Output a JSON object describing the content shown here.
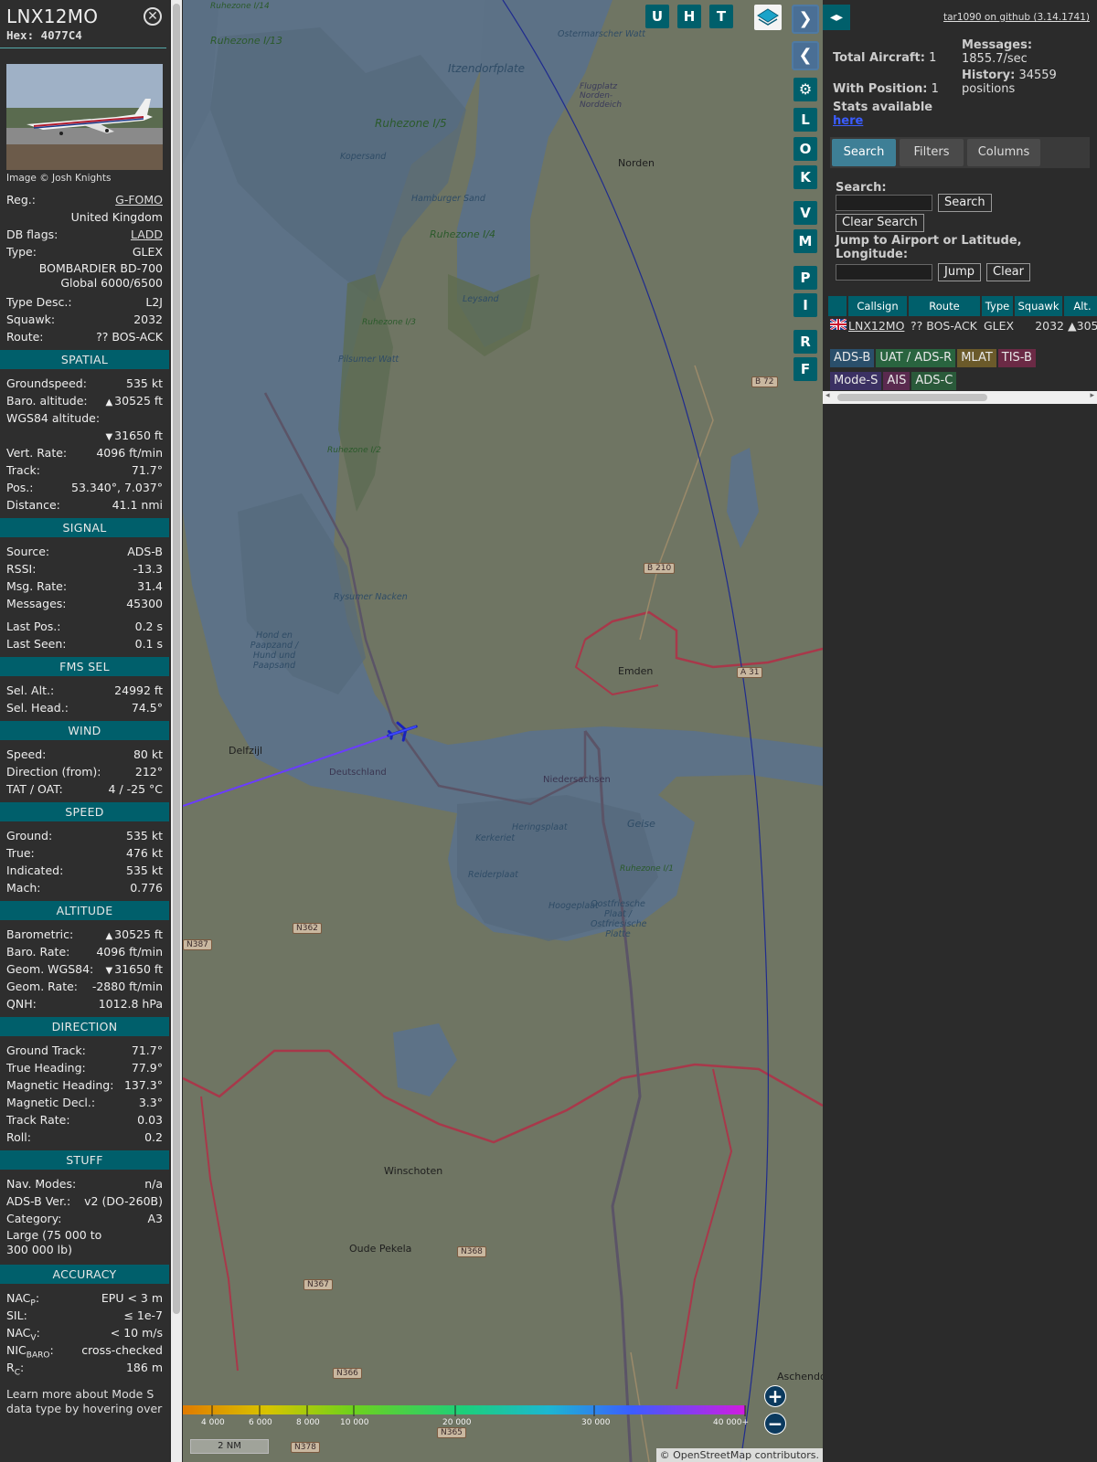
{
  "sidebar": {
    "callsign": "LNX12MO",
    "hex": "Hex: 4077C4",
    "photo_credit": "Image © Josh Knights",
    "info": [
      {
        "k": "Reg.:",
        "v": "G-FOMO",
        "link": true
      },
      {
        "k": "",
        "v": "United Kingdom"
      },
      {
        "k": "DB flags:",
        "v": "LADD",
        "link": true
      },
      {
        "k": "Type:",
        "v": "GLEX"
      },
      {
        "k": "",
        "v": "BOMBARDIER BD-700 Global 6000/6500",
        "tall": true
      },
      {
        "k": "Type Desc.:",
        "v": "L2J"
      },
      {
        "k": "Squawk:",
        "v": "2032"
      },
      {
        "k": "Route:",
        "v": "?? BOS-ACK"
      }
    ],
    "sections": [
      {
        "title": "SPATIAL",
        "rows": [
          {
            "k": "Groundspeed:",
            "v": "535 kt"
          },
          {
            "k": "Baro. altitude:",
            "v": "30525 ft",
            "arrow": "up"
          },
          {
            "k": "WGS84 altitude:",
            "v": ""
          },
          {
            "k": "",
            "v": "31650 ft",
            "arrow": "down"
          },
          {
            "k": "Vert. Rate:",
            "v": "4096 ft/min"
          },
          {
            "k": "Track:",
            "v": "71.7°"
          },
          {
            "k": "Pos.:",
            "v": "53.340°, 7.037°"
          },
          {
            "k": "Distance:",
            "v": "41.1 nmi"
          }
        ]
      },
      {
        "title": "SIGNAL",
        "rows": [
          {
            "k": "Source:",
            "v": "ADS-B"
          },
          {
            "k": "RSSI:",
            "v": "-13.3"
          },
          {
            "k": "Msg. Rate:",
            "v": "31.4"
          },
          {
            "k": "Messages:",
            "v": "45300"
          },
          {
            "k": "",
            "v": "",
            "gap": true
          },
          {
            "k": "Last Pos.:",
            "v": "0.2 s"
          },
          {
            "k": "Last Seen:",
            "v": "0.1 s"
          }
        ]
      },
      {
        "title": "FMS SEL",
        "rows": [
          {
            "k": "Sel. Alt.:",
            "v": "24992 ft"
          },
          {
            "k": "Sel. Head.:",
            "v": "74.5°"
          }
        ]
      },
      {
        "title": "WIND",
        "rows": [
          {
            "k": "Speed:",
            "v": "80 kt"
          },
          {
            "k": "Direction (from):",
            "v": "212°"
          },
          {
            "k": "TAT / OAT:",
            "v": "4 / -25 °C"
          }
        ]
      },
      {
        "title": "SPEED",
        "rows": [
          {
            "k": "Ground:",
            "v": "535 kt"
          },
          {
            "k": "True:",
            "v": "476 kt"
          },
          {
            "k": "Indicated:",
            "v": "535 kt"
          },
          {
            "k": "Mach:",
            "v": "0.776"
          }
        ]
      },
      {
        "title": "ALTITUDE",
        "rows": [
          {
            "k": "Barometric:",
            "v": "30525 ft",
            "arrow": "up"
          },
          {
            "k": "Baro. Rate:",
            "v": "4096 ft/min"
          },
          {
            "k": "Geom. WGS84:",
            "v": "31650 ft",
            "arrow": "down"
          },
          {
            "k": "Geom. Rate:",
            "v": "-2880 ft/min"
          },
          {
            "k": "QNH:",
            "v": "1012.8 hPa"
          }
        ]
      },
      {
        "title": "DIRECTION",
        "rows": [
          {
            "k": "Ground Track:",
            "v": "71.7°"
          },
          {
            "k": "True Heading:",
            "v": "77.9°"
          },
          {
            "k": "Magnetic Heading:",
            "v": "137.3°"
          },
          {
            "k": "Magnetic Decl.:",
            "v": "3.3°"
          },
          {
            "k": "Track Rate:",
            "v": "0.03"
          },
          {
            "k": "Roll:",
            "v": "0.2"
          }
        ]
      },
      {
        "title": "STUFF",
        "rows": [
          {
            "k": "Nav. Modes:",
            "v": "n/a"
          },
          {
            "k": "ADS-B Ver.:",
            "v": "v2 (DO-260B)"
          },
          {
            "k": "Category:",
            "v": "A3"
          },
          {
            "k": "Large (75 000 to 300 000 lb)",
            "v": "",
            "tallk": true
          }
        ]
      },
      {
        "title": "ACCURACY",
        "rows": [
          {
            "k": "NAC",
            "sub": "P",
            "v": "EPU < 3 m"
          },
          {
            "k": "SIL:",
            "v": "≤ 1e-7"
          },
          {
            "k": "NAC",
            "sub": "V",
            "v": "< 10 m/s"
          },
          {
            "k": "NIC",
            "sub": "BARO",
            "v": "cross-checked"
          },
          {
            "k": "R",
            "sub": "C",
            "v": "186 m"
          }
        ]
      }
    ],
    "learn_more": "Learn more about Mode S data type by hovering over"
  },
  "map": {
    "buttons_top": [
      "U",
      "H",
      "T"
    ],
    "buttons_side": [
      "L",
      "O",
      "K",
      "V",
      "M",
      "P",
      "I",
      "R",
      "F"
    ],
    "towns": [
      {
        "name": "Norden"
      },
      {
        "name": "Emden"
      },
      {
        "name": "Delfzijl"
      },
      {
        "name": "Winschoten"
      },
      {
        "name": "Oude Pekela"
      },
      {
        "name": "Aschendo"
      }
    ],
    "zones": [
      "Ruhezone I/5",
      "Ruhezone I/4",
      "Ruhezone I/13",
      "Ruhezone I/3",
      "Ruhezone I/2",
      "Ruhezone I/1",
      "Ruhezone I/14"
    ],
    "water_labels": [
      "Itzendorfplate",
      "Ostermarscher Watt",
      "Kopersand",
      "Hamburger Sand",
      "Leysand",
      "Pilsumer Watt",
      "Rysumer Nacken",
      "Hond en Paapzand / Hund und Paapsand",
      "Heringsplaat",
      "Kerkeriet",
      "Geise",
      "Reiderplaat",
      "Hoogeplaat",
      "Oostfriesche Plaat / Ostfriesische Platte",
      "Niedersachsen",
      "Deutschland",
      "Flugplatz Norden-Norddeich"
    ],
    "roads": [
      "B 72",
      "B 210",
      "A 31",
      "N362",
      "N387",
      "N367",
      "N368",
      "N366",
      "N365",
      "N378"
    ],
    "alt_scale": [
      "4 000",
      "6 000",
      "8 000",
      "10 000",
      "20 000",
      "30 000",
      "40 000+"
    ],
    "scale_label": "2 NM",
    "attribution_prefix": "© ",
    "attribution_link": "OpenStreetMap",
    "attribution_suffix": " contributors.",
    "zoom_in": "+",
    "zoom_out": "−"
  },
  "panel": {
    "github": "tar1090 on github (3.14.1741)",
    "total_aircraft_label": "Total Aircraft:",
    "total_aircraft": "1",
    "with_position_label": "With Position:",
    "with_position": "1",
    "messages_label": "Messages:",
    "messages": "1855.7/sec",
    "history_label": "History:",
    "history": "34559 positions",
    "stats_label": "Stats available",
    "stats_link": "here",
    "tabs": [
      "Search",
      "Filters",
      "Columns"
    ],
    "search_label": "Search:",
    "search_button": "Search",
    "clear_search": "Clear Search",
    "jump_label": "Jump to Airport or Latitude, Longitude:",
    "jump_button": "Jump",
    "clear_button": "Clear",
    "columns": [
      "",
      "Callsign",
      "Route",
      "Type",
      "Squawk",
      "Alt."
    ],
    "row": {
      "callsign": "LNX12MO",
      "route": "?? BOS-ACK",
      "type": "GLEX",
      "squawk": "2032",
      "alt": "▲305"
    },
    "chips": [
      {
        "label": "ADS-B",
        "bg": "#2a4f6b",
        "fg": "#e8e8e8"
      },
      {
        "label": "UAT / ADS-R",
        "bg": "#29643f",
        "fg": "#e8e8e8"
      },
      {
        "label": "MLAT",
        "bg": "#6b5a2a",
        "fg": "#e8e8e8"
      },
      {
        "label": "TIS-B",
        "bg": "#6b2a45",
        "fg": "#e8e8e8"
      },
      {
        "label": "Mode-S",
        "bg": "#3b3163",
        "fg": "#e8e8e8"
      },
      {
        "label": "AIS",
        "bg": "#5a2a4f",
        "fg": "#e8e8e8"
      },
      {
        "label": "ADS-C",
        "bg": "#2a5a3a",
        "fg": "#e8e8e8"
      }
    ]
  }
}
